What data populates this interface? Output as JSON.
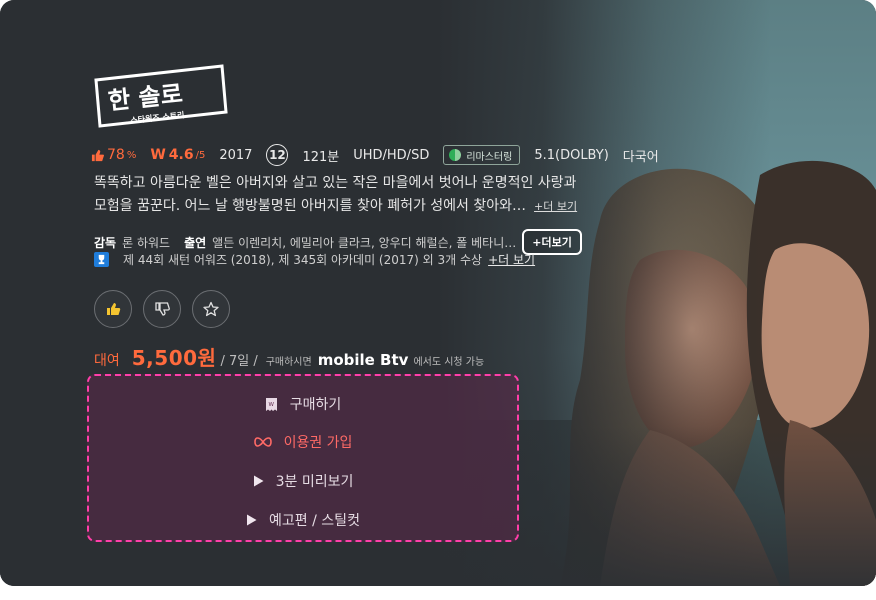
{
  "movie": {
    "logo_title": "한 솔로",
    "logo_subtitle": "스타워즈 스토리",
    "rating_percent": "78",
    "rating_percent_unit": "%",
    "watcha_score": "4.6",
    "watcha_scale": "/5",
    "year": "2017",
    "age_rating": "12",
    "runtime": "121분",
    "quality": "UHD/HD/SD",
    "remaster_badge": "리마스터링",
    "audio": "5.1(DOLBY)",
    "language": "다국어",
    "synopsis_line1": "똑똑하고 아름다운 벨은 아버지와 살고 있는 작은 마을에서 벗어나 운명적인 사랑과",
    "synopsis_line2": "모험을 꿈꾼다. 어느 날 행방불명된 아버지를 찾아 폐허가 성에서 찾아와…",
    "synopsis_more": "+더 보기",
    "director_label": "감독",
    "director": "론 하워드",
    "cast_label": "출연",
    "cast": "앨든 이렌리치, 에밀리아 클라크, 앙우디 해럴슨, 폴 베타니…",
    "cast_more": "+더보기",
    "awards": "제 44회 새턴 어워즈 (2018), 제 345회 아카데미 (2017) 외 3개 수상",
    "awards_more": "+더 보기"
  },
  "reactions": {
    "like_icon": "thumbs-up-icon",
    "dislike_icon": "thumbs-down-icon",
    "favorite_icon": "star-icon"
  },
  "price": {
    "rent_label": "대여",
    "amount": "5,500원",
    "period": "/ 7일 /",
    "note": "구매하시면",
    "btv_logo": "mobile Btv",
    "note2": "에서도 시청 가능"
  },
  "actions": [
    {
      "label": "구매하기",
      "icon": "receipt-icon"
    },
    {
      "label": "이용권 가입",
      "icon": "infinity-icon"
    },
    {
      "label": "3분 미리보기",
      "icon": "play-icon"
    },
    {
      "label": "예고편 / 스틸컷",
      "icon": "play-icon"
    }
  ],
  "colors": {
    "accent": "#ff6a3d",
    "focus_border": "#ff3ea9",
    "background": "#2b2f33"
  }
}
